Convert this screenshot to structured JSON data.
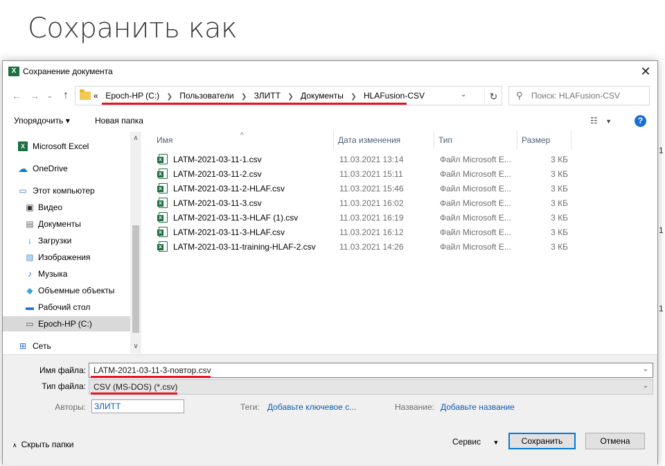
{
  "background": {
    "title": "Сохранить как",
    "side_numbers": [
      "1",
      "1",
      "1"
    ]
  },
  "dialog": {
    "title": "Сохранение документа",
    "app_icon": "excel-icon"
  },
  "navigation": {
    "address": {
      "overflow": "«",
      "crumbs": [
        "Epoch-HP (C:)",
        "Пользователи",
        "ЗЛИТТ",
        "Документы",
        "HLAFusion-CSV"
      ]
    },
    "search_placeholder": "Поиск: HLAFusion-CSV"
  },
  "toolbar": {
    "organize": "Упорядочить ▾",
    "new_folder": "Новая папка"
  },
  "nav_pane": {
    "items": [
      {
        "label": "Microsoft Excel",
        "icon": "excel-icon"
      },
      {
        "label": "OneDrive",
        "icon": "cloud-icon"
      },
      {
        "label": "Этот компьютер",
        "icon": "computer-icon"
      },
      {
        "label": "Видео",
        "icon": "video-icon"
      },
      {
        "label": "Документы",
        "icon": "document-icon"
      },
      {
        "label": "Загрузки",
        "icon": "download-icon"
      },
      {
        "label": "Изображения",
        "icon": "image-icon"
      },
      {
        "label": "Музыка",
        "icon": "music-icon"
      },
      {
        "label": "Объемные объекты",
        "icon": "cube-icon"
      },
      {
        "label": "Рабочий стол",
        "icon": "desktop-icon"
      },
      {
        "label": "Epoch-HP (C:)",
        "icon": "drive-icon"
      },
      {
        "label": "Сеть",
        "icon": "network-icon"
      }
    ]
  },
  "file_list": {
    "columns": [
      "Имя",
      "Дата изменения",
      "Тип",
      "Размер"
    ],
    "rows": [
      {
        "name": "LATM-2021-03-11-1.csv",
        "date": "11.03.2021 13:14",
        "type": "Файл Microsoft E...",
        "size": "3 КБ"
      },
      {
        "name": "LATM-2021-03-11-2.csv",
        "date": "11.03.2021 15:11",
        "type": "Файл Microsoft E...",
        "size": "3 КБ"
      },
      {
        "name": "LATM-2021-03-11-2-HLAF.csv",
        "date": "11.03.2021 15:46",
        "type": "Файл Microsoft E...",
        "size": "3 КБ"
      },
      {
        "name": "LATM-2021-03-11-3.csv",
        "date": "11.03.2021 16:02",
        "type": "Файл Microsoft E...",
        "size": "3 КБ"
      },
      {
        "name": "LATM-2021-03-11-3-HLAF (1).csv",
        "date": "11.03.2021 16:19",
        "type": "Файл Microsoft E...",
        "size": "3 КБ"
      },
      {
        "name": "LATM-2021-03-11-3-HLAF.csv",
        "date": "11.03.2021 16:12",
        "type": "Файл Microsoft E...",
        "size": "3 КБ"
      },
      {
        "name": "LATM-2021-03-11-training-HLAF-2.csv",
        "date": "11.03.2021 14:26",
        "type": "Файл Microsoft E...",
        "size": "3 КБ"
      }
    ]
  },
  "form": {
    "filename_label": "Имя файла:",
    "filename_value": "LATM-2021-03-11-3-повтор.csv",
    "filetype_label": "Тип файла:",
    "filetype_value": "CSV (MS-DOS) (*.csv)",
    "authors_label": "Авторы:",
    "authors_value": "ЗЛИТТ",
    "tags_label": "Теги:",
    "tags_value": "Добавьте ключевое с...",
    "name_label": "Название:",
    "name_value": "Добавьте название"
  },
  "footer": {
    "hide_folders": "Скрыть папки",
    "service": "Сервис",
    "save": "Сохранить",
    "cancel": "Отмена"
  },
  "colors": {
    "highlight": "#e81123",
    "excel_green": "#1d6f42",
    "link": "#0c5bb5",
    "primary_border": "#0078d7"
  }
}
